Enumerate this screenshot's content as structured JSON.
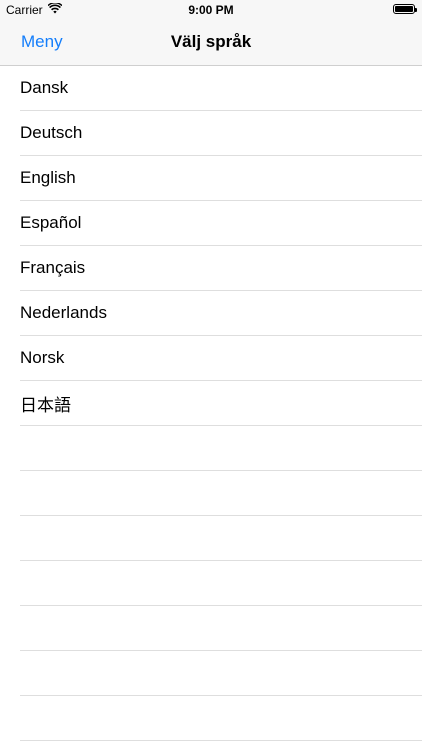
{
  "status_bar": {
    "carrier": "Carrier",
    "wifi_icon": "wifi-icon",
    "time": "9:00 PM",
    "battery_icon": "battery-icon",
    "battery_level": 1.0
  },
  "nav": {
    "back_label": "Meny",
    "title": "Välj språk",
    "accent_color": "#147efb"
  },
  "languages": [
    "Dansk",
    "Deutsch",
    "English",
    "Español",
    "Français",
    "Nederlands",
    "Norsk",
    "日本語"
  ]
}
